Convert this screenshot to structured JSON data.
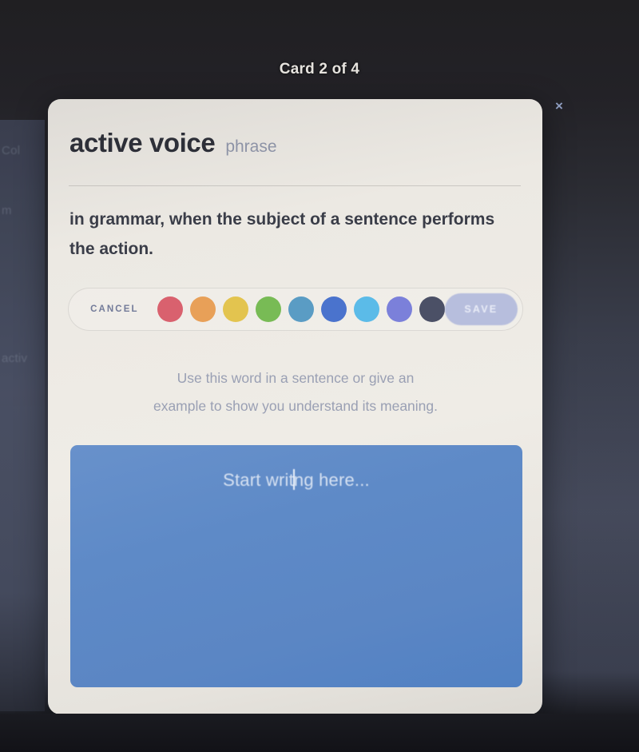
{
  "header": {
    "card_counter": "Card 2 of 4",
    "close_icon": "close-icon",
    "close_glyph": "×"
  },
  "card": {
    "term": "active voice",
    "part_of_speech": "phrase",
    "definition": "in grammar, when the subject of a sentence performs the action.",
    "prompt_line_1": "Use this word in a sentence or give an",
    "prompt_line_2": "example to show you understand its meaning."
  },
  "color_toolbar": {
    "cancel_label": "CANCEL",
    "save_label": "SAVE",
    "save_background": "#b7bedd",
    "swatches": [
      {
        "name": "red",
        "hex": "#d9616e"
      },
      {
        "name": "orange",
        "hex": "#e8a058"
      },
      {
        "name": "yellow",
        "hex": "#e3c44f"
      },
      {
        "name": "green",
        "hex": "#78bb55"
      },
      {
        "name": "teal-blue",
        "hex": "#5a9cc4"
      },
      {
        "name": "indigo",
        "hex": "#4a73cd"
      },
      {
        "name": "sky-blue",
        "hex": "#5bbbe8"
      },
      {
        "name": "periwinkle",
        "hex": "#7b80da"
      },
      {
        "name": "dark-slate",
        "hex": "#4b5066"
      }
    ]
  },
  "response": {
    "placeholder_before_caret": "Start writ",
    "placeholder_after_caret": "ng here...",
    "background": "#5e8ac7",
    "value": ""
  },
  "background": {
    "ghost_lines": [
      "Col",
      "m",
      "activ"
    ]
  }
}
